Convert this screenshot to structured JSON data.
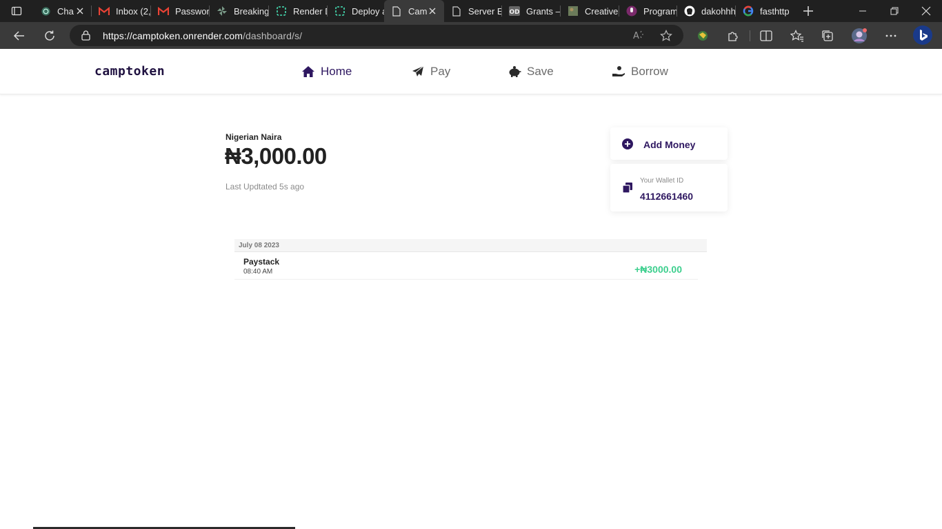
{
  "browser": {
    "tabs": [
      {
        "title": "Cha",
        "icon": "chatgpt-icon",
        "active": false,
        "closable": true
      },
      {
        "title": "Inbox (2,",
        "icon": "gmail-icon",
        "active": false,
        "closable": false
      },
      {
        "title": "Passworc",
        "icon": "gmail-icon",
        "active": false,
        "closable": false
      },
      {
        "title": "Breaking",
        "icon": "pinwheel-icon",
        "active": false,
        "closable": false
      },
      {
        "title": "Render D",
        "icon": "render-icon",
        "active": false,
        "closable": false
      },
      {
        "title": "Deploy a",
        "icon": "render-icon",
        "active": false,
        "closable": false
      },
      {
        "title": "Cam",
        "icon": "page-icon",
        "active": true,
        "closable": true
      },
      {
        "title": "Server Er",
        "icon": "page-icon",
        "active": false,
        "closable": false
      },
      {
        "title": "Grants –",
        "icon": "od-icon",
        "active": false,
        "closable": false
      },
      {
        "title": "Creative",
        "icon": "photo-icon",
        "active": false,
        "closable": false
      },
      {
        "title": "Program",
        "icon": "podcast-icon",
        "active": false,
        "closable": false
      },
      {
        "title": "dakohhh",
        "icon": "github-icon",
        "active": false,
        "closable": false
      },
      {
        "title": "fasthttp",
        "icon": "google-icon",
        "active": false,
        "closable": false
      }
    ],
    "address": {
      "host": "https://camptoken.onrender.com",
      "path": "/dashboard/s/"
    }
  },
  "site": {
    "brand": "camptoken",
    "nav": [
      {
        "label": "Home",
        "icon": "home-icon",
        "active": true
      },
      {
        "label": "Pay",
        "icon": "paper-plane-icon",
        "active": false
      },
      {
        "label": "Save",
        "icon": "piggy-bank-icon",
        "active": false
      },
      {
        "label": "Borrow",
        "icon": "hand-coin-icon",
        "active": false
      }
    ]
  },
  "dashboard": {
    "currency_label": "Nigerian Naira",
    "balance": "₦3,000.00",
    "last_updated": "Last Updtated 5s ago",
    "add_money_label": "Add Money",
    "wallet_label": "Your Wallet ID",
    "wallet_id": "4112661460"
  },
  "transactions": {
    "date": "July 08 2023",
    "items": [
      {
        "name": "Paystack",
        "time": "08:40 AM",
        "amount": "+₦3000.00"
      }
    ]
  },
  "colors": {
    "brand": "#1f1140",
    "accent": "#2e1760",
    "credit": "#3dcf8e",
    "chrome_dark": "#202020",
    "chrome_toolbar": "#3a3a3a"
  }
}
